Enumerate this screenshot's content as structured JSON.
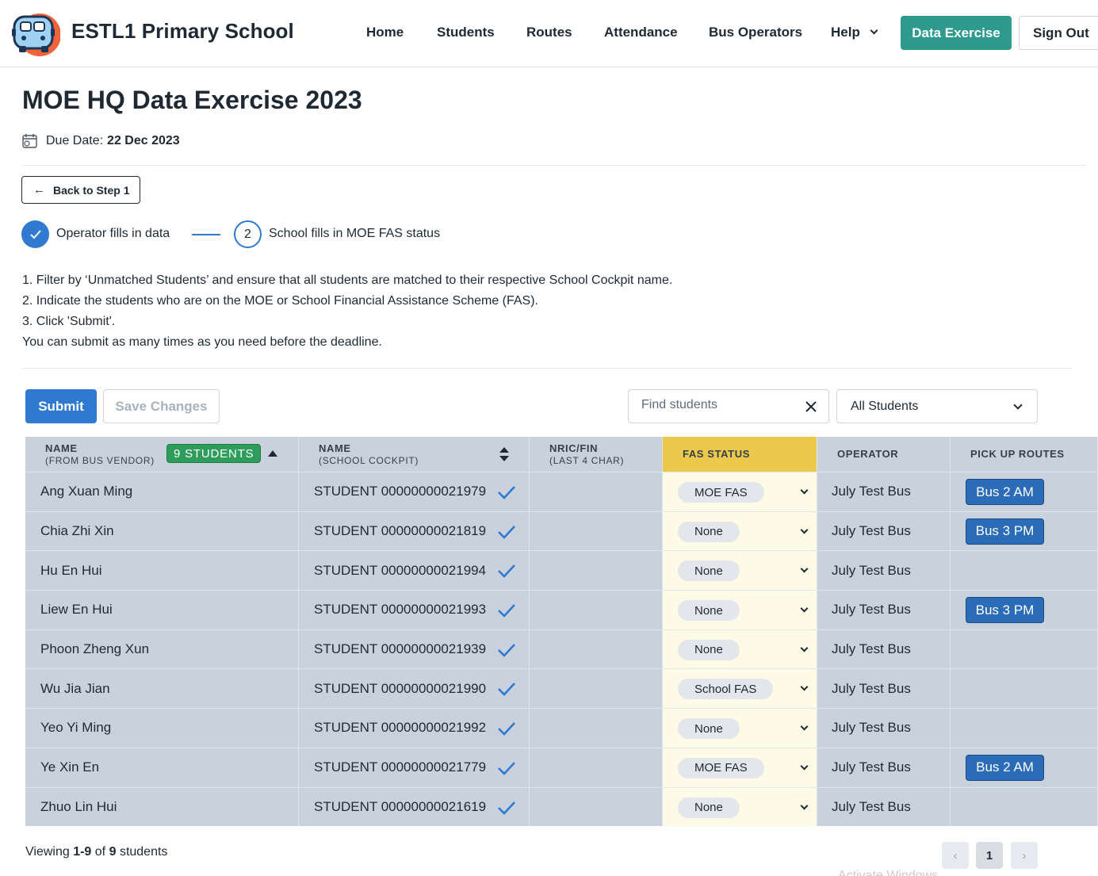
{
  "header": {
    "school_name": "ESTL1 Primary School",
    "nav": [
      "Home",
      "Students",
      "Routes",
      "Attendance",
      "Bus Operators",
      "Help"
    ],
    "data_exercise_label": "Data Exercise",
    "sign_out_label": "Sign Out",
    "accent_color": "#2e9a8e"
  },
  "page": {
    "title": "MOE HQ Data Exercise 2023",
    "due_label": "Due Date:",
    "due_date": "22 Dec 2023",
    "back_label": "Back to Step 1"
  },
  "stepper": {
    "step1_label": "Operator fills in data",
    "step2_number": "2",
    "step2_label": "School fills in MOE FAS status"
  },
  "instructions": [
    "1. Filter by ‘Unmatched Students’ and ensure that all students are matched to their respective School Cockpit name.",
    "2. Indicate the students who are on the MOE or School Financial Assistance Scheme (FAS).",
    "3. Click 'Submit'.",
    "You can submit as many times as you need before the deadline."
  ],
  "toolbar": {
    "submit_label": "Submit",
    "save_label": "Save Changes",
    "search_placeholder": "Find students",
    "filter_value": "All Students"
  },
  "table": {
    "headers": {
      "name_vendor": "NAME",
      "name_vendor_sub": "(FROM BUS VENDOR)",
      "count_badge": "9 STUDENTS",
      "name_cockpit": "NAME",
      "name_cockpit_sub": "(SCHOOL COCKPIT)",
      "nric": "NRIC/FIN",
      "nric_sub": "(LAST 4 CHAR)",
      "fas": "FAS STATUS",
      "operator": "OPERATOR",
      "routes": "PICK UP ROUTES"
    },
    "rows": [
      {
        "vendor_name": "Ang Xuan Ming",
        "cockpit_name": "STUDENT 00000000021979",
        "nric": "",
        "fas": "MOE FAS",
        "operator": "July Test Bus",
        "route": "Bus 2 AM"
      },
      {
        "vendor_name": "Chia Zhi Xin",
        "cockpit_name": "STUDENT 00000000021819",
        "nric": "",
        "fas": "None",
        "operator": "July Test Bus",
        "route": "Bus 3 PM"
      },
      {
        "vendor_name": "Hu En Hui",
        "cockpit_name": "STUDENT 00000000021994",
        "nric": "",
        "fas": "None",
        "operator": "July Test Bus",
        "route": ""
      },
      {
        "vendor_name": "Liew En Hui",
        "cockpit_name": "STUDENT 00000000021993",
        "nric": "",
        "fas": "None",
        "operator": "July Test Bus",
        "route": "Bus 3 PM"
      },
      {
        "vendor_name": "Phoon Zheng Xun",
        "cockpit_name": "STUDENT 00000000021939",
        "nric": "",
        "fas": "None",
        "operator": "July Test Bus",
        "route": ""
      },
      {
        "vendor_name": "Wu Jia Jian",
        "cockpit_name": "STUDENT 00000000021990",
        "nric": "",
        "fas": "School FAS",
        "operator": "July Test Bus",
        "route": ""
      },
      {
        "vendor_name": "Yeo Yi Ming",
        "cockpit_name": "STUDENT 00000000021992",
        "nric": "",
        "fas": "None",
        "operator": "July Test Bus",
        "route": ""
      },
      {
        "vendor_name": "Ye Xin En",
        "cockpit_name": "STUDENT 00000000021779",
        "nric": "",
        "fas": "MOE FAS",
        "operator": "July Test Bus",
        "route": "Bus 2 AM"
      },
      {
        "vendor_name": "Zhuo Lin Hui",
        "cockpit_name": "STUDENT 00000000021619",
        "nric": "",
        "fas": "None",
        "operator": "July Test Bus",
        "route": ""
      }
    ]
  },
  "footer": {
    "viewing_prefix": "Viewing",
    "range": "1-9",
    "of_label": "of",
    "total": "9",
    "suffix": "students",
    "current_page": "1",
    "prev_glyph": "‹",
    "next_glyph": "›"
  },
  "watermark": "Activate Windows"
}
